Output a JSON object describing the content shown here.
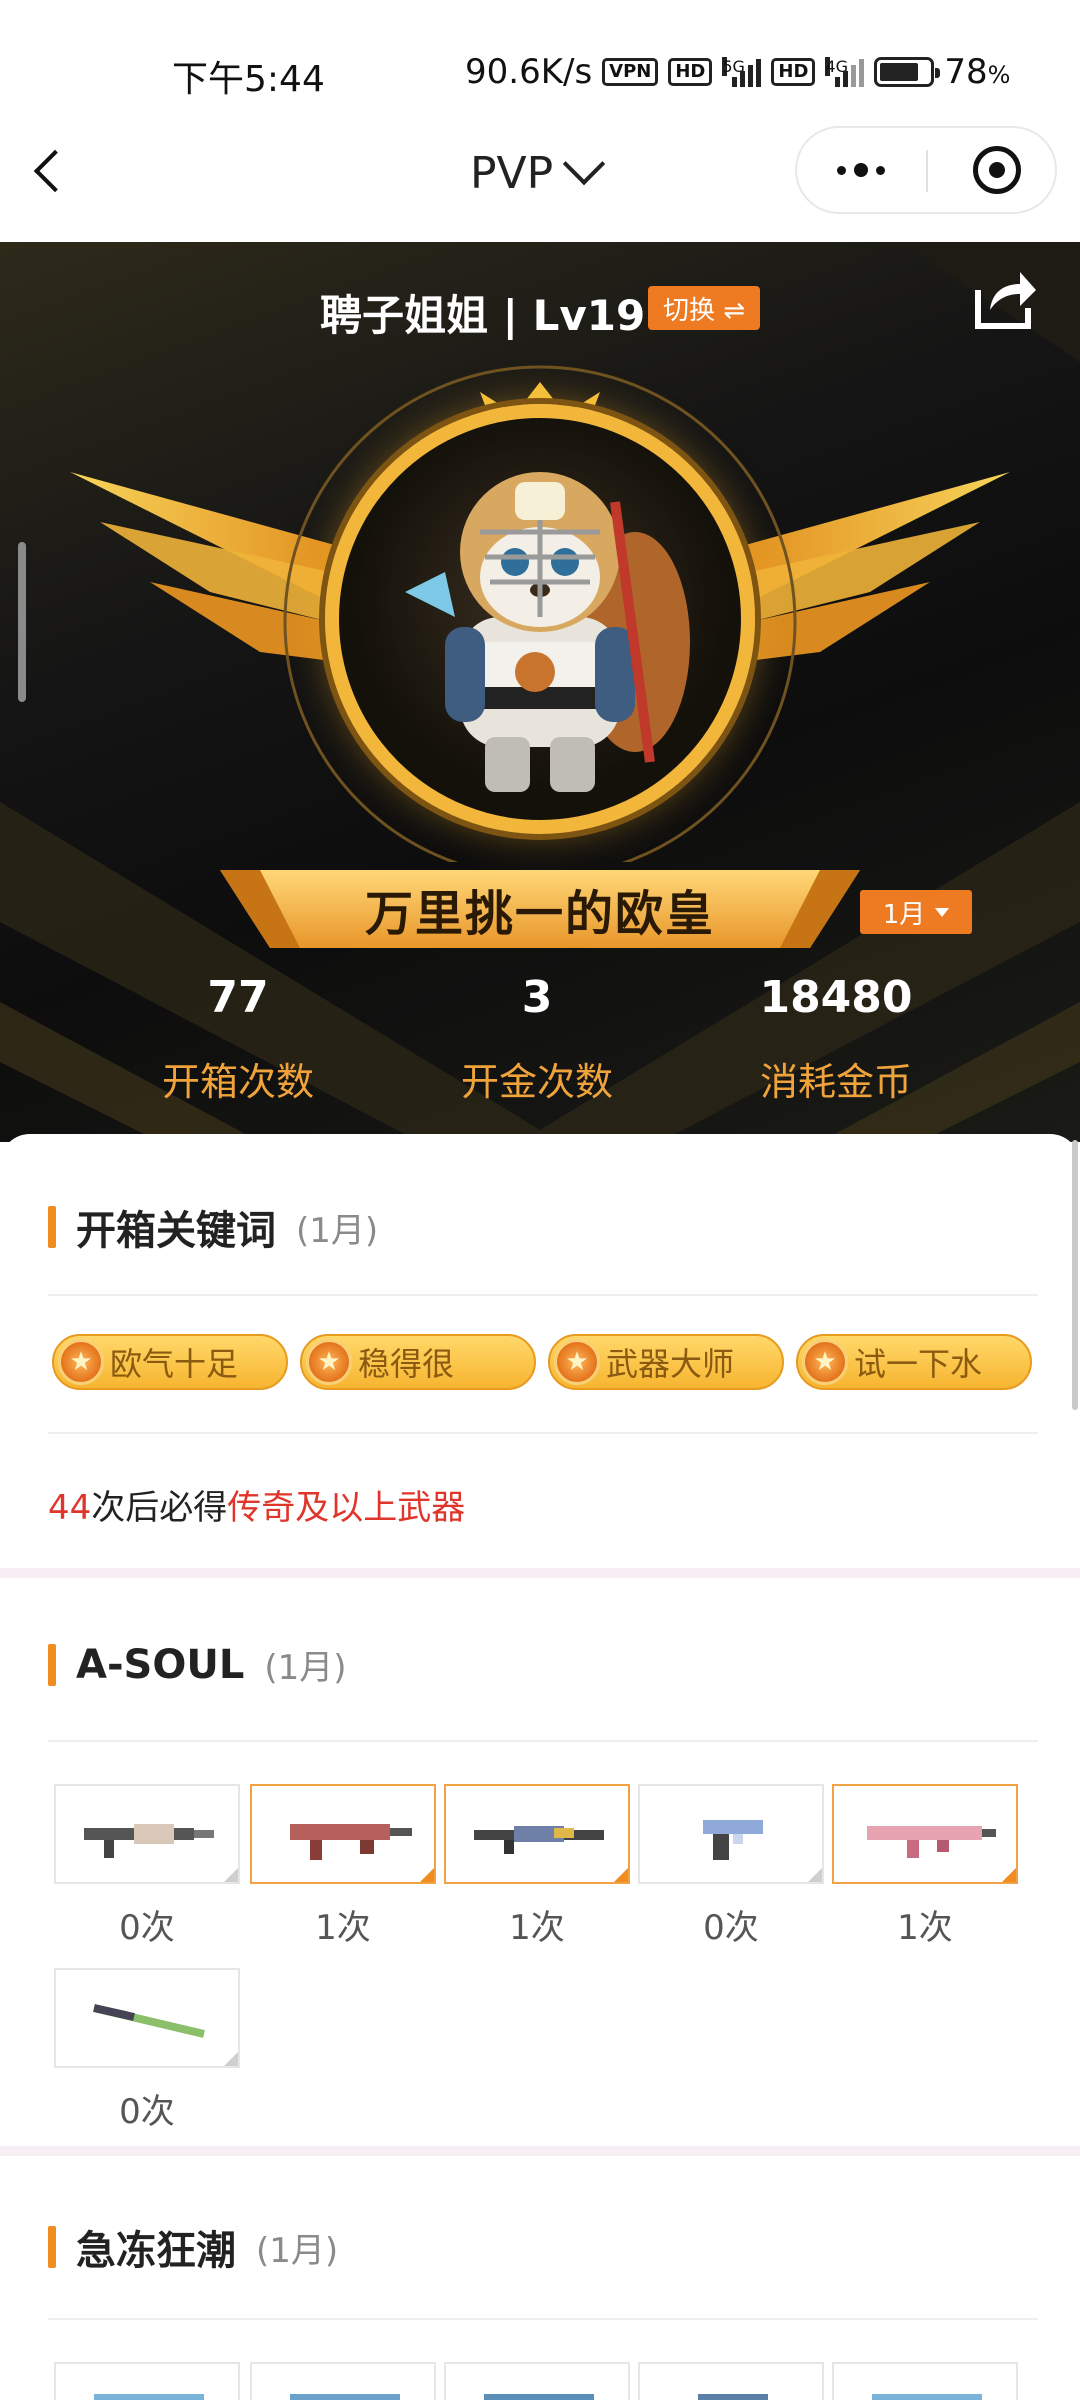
{
  "status_bar": {
    "time": "下午5:44",
    "speed": "90.6K/s",
    "vpn": "VPN",
    "hd1": "HD",
    "net1": "5G",
    "hd2": "HD",
    "net2": "4G",
    "battery_level": 0.78,
    "battery_pct": "78",
    "pct_sign": "%"
  },
  "nav": {
    "title": "PVP"
  },
  "profile": {
    "name_level": "聘子姐姐 | Lv19",
    "switch_label": "切换 ⇌",
    "rank_title": "万里挑一的欧皇",
    "month_selector": "1月"
  },
  "stats": [
    {
      "value": "77",
      "label": "开箱次数"
    },
    {
      "value": "3",
      "label": "开金次数"
    },
    {
      "value": "18480",
      "label": "消耗金币"
    }
  ],
  "keywords_section": {
    "title": "开箱关键词",
    "month": "(1月)",
    "keywords": [
      "欧气十足",
      "稳得很",
      "武器大师",
      "试一下水"
    ],
    "guarantee_count": "44",
    "guarantee_mid": "次后必得",
    "guarantee_item": "传奇及以上武器"
  },
  "asoul_section": {
    "title": "A-SOUL",
    "month": "(1月)",
    "items": [
      {
        "count": "0次",
        "owned": false
      },
      {
        "count": "1次",
        "owned": true
      },
      {
        "count": "1次",
        "owned": true
      },
      {
        "count": "0次",
        "owned": false
      },
      {
        "count": "1次",
        "owned": true
      },
      {
        "count": "0次",
        "owned": false
      }
    ]
  },
  "frozen_section": {
    "title": "急冻狂潮",
    "month": "(1月)"
  },
  "colors": {
    "accent": "#f08c20",
    "button_orange": "#ee7a21",
    "stat_label": "#f0a33a",
    "highlight_red": "#e0352b"
  }
}
